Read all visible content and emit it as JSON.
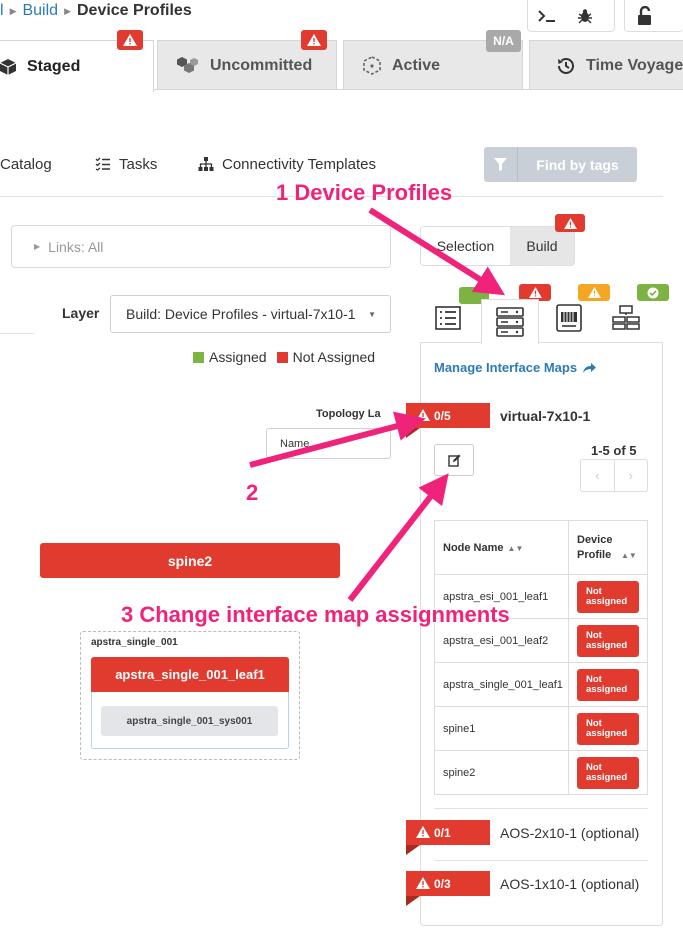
{
  "breadcrumb": {
    "root": "l",
    "build": "Build",
    "current": "Device Profiles"
  },
  "tabs": [
    {
      "label": "Staged"
    },
    {
      "label": "Uncommitted"
    },
    {
      "label": "Active",
      "badge": "N/A"
    },
    {
      "label": "Time Voyager"
    }
  ],
  "subnav": {
    "catalog": "Catalog",
    "tasks": "Tasks",
    "connectivity_templates": "Connectivity Templates",
    "find_by_tags": "Find by tags"
  },
  "links_filter": "Links: All",
  "view_toggle": {
    "selection": "Selection",
    "build": "Build"
  },
  "layer": {
    "label": "Layer",
    "value": "Build: Device Profiles - virtual-7x10-1"
  },
  "legend": {
    "assigned": "Assigned",
    "not_assigned": "Not Assigned"
  },
  "topology": {
    "label": "Topology La",
    "name_select": "Name"
  },
  "nodes": {
    "spine2": "spine2",
    "group_label": "apstra_single_001",
    "leaf": "apstra_single_001_leaf1",
    "system": "apstra_single_001_sys001"
  },
  "panel": {
    "manage_link": "Manage Interface Maps",
    "profile": {
      "count": "0/5",
      "name": "virtual-7x10-1"
    },
    "pagination": "1-5 of 5",
    "columns": [
      "Node Name",
      "Device Profile"
    ],
    "rows": [
      {
        "node": "apstra_esi_001_leaf1",
        "status": "Not assigned"
      },
      {
        "node": "apstra_esi_001_leaf2",
        "status": "Not assigned"
      },
      {
        "node": "apstra_single_001_leaf1",
        "status": "Not assigned"
      },
      {
        "node": "spine1",
        "status": "Not assigned"
      },
      {
        "node": "spine2",
        "status": "Not assigned"
      }
    ],
    "optional": [
      {
        "count": "0/1",
        "name": "AOS-2x10-1 (optional)"
      },
      {
        "count": "0/3",
        "name": "AOS-1x10-1 (optional)"
      }
    ]
  },
  "annotations": {
    "a1": "1 Device Profiles",
    "a2": "2",
    "a3": "3 Change interface map assignments"
  },
  "colors": {
    "error": "#e13b2f",
    "success": "#7cb342",
    "warning": "#f5a623",
    "link": "#2b7bb9",
    "annotation": "#f0237a"
  }
}
